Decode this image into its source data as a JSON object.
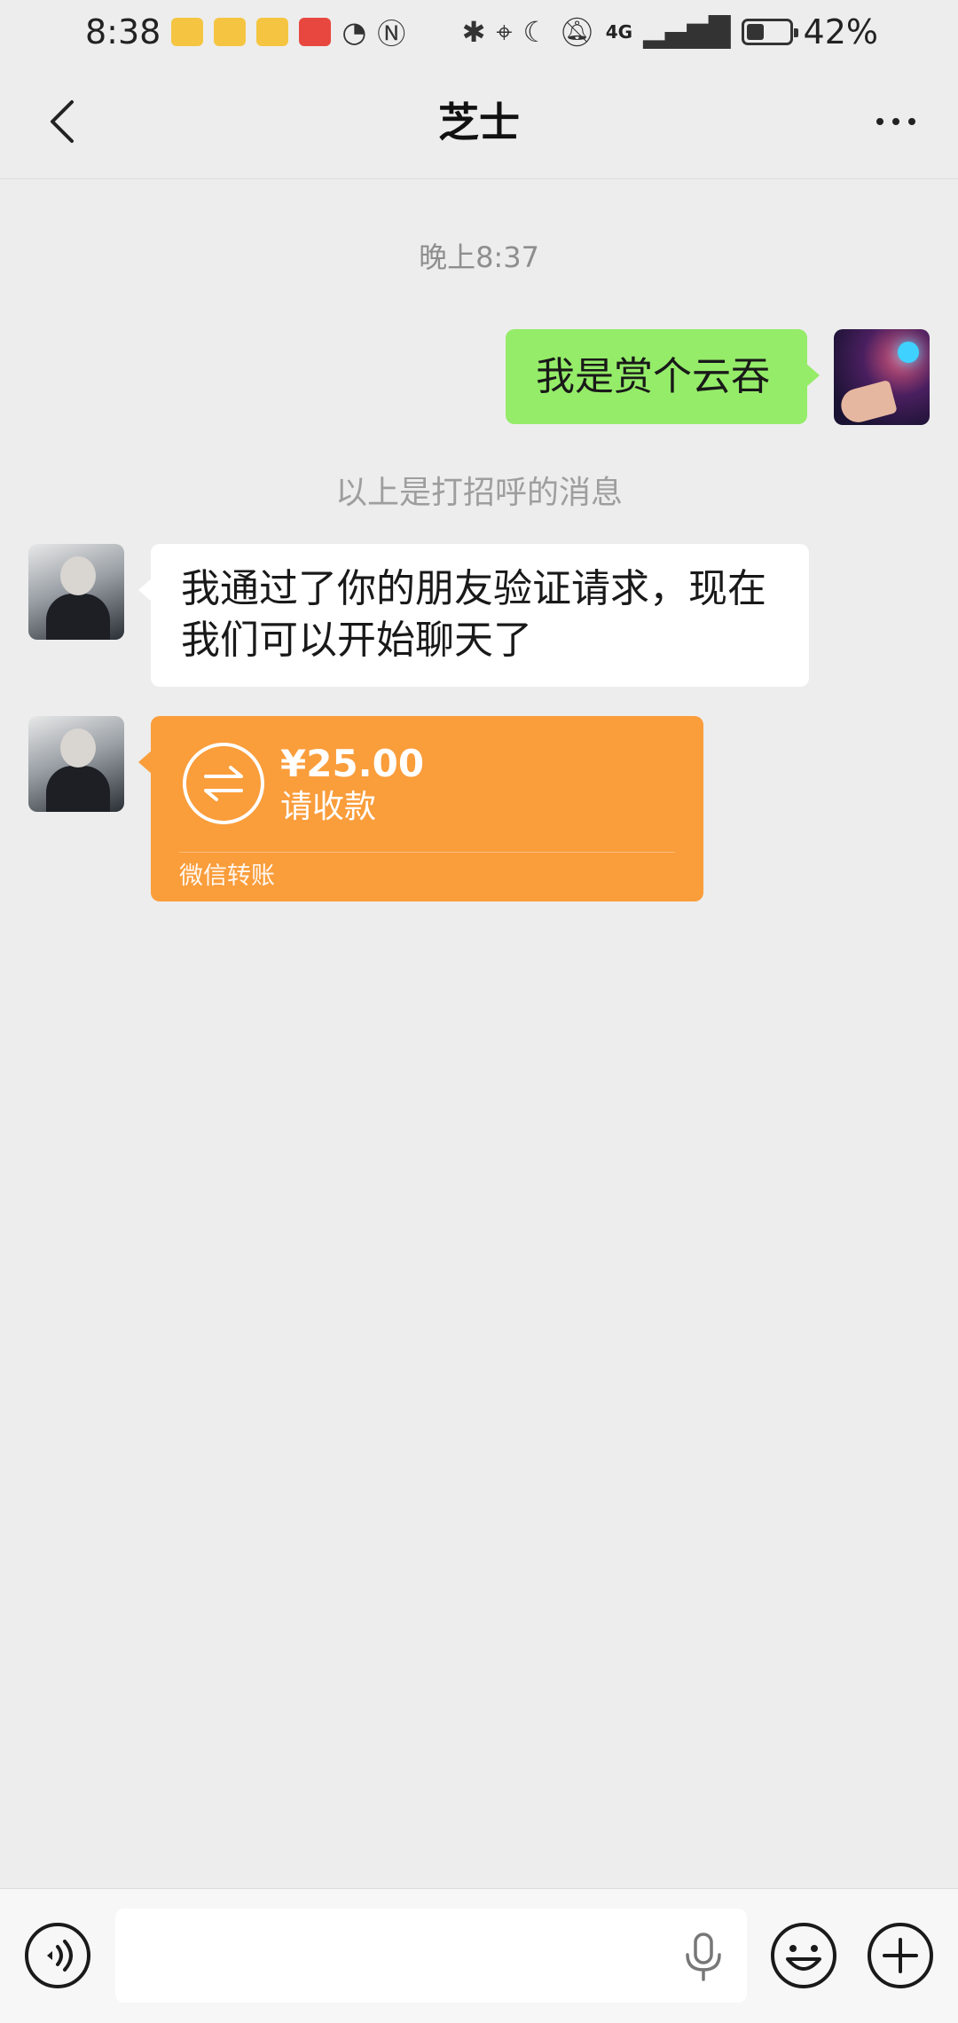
{
  "status_bar": {
    "time": "8:38",
    "network": "4G",
    "battery_percent_text": "42%",
    "battery_level": 0.42
  },
  "header": {
    "title": "芝士"
  },
  "chat": {
    "timestamp": "晚上8:37",
    "messages": [
      {
        "from": "self",
        "text": "我是赏个云吞"
      },
      {
        "from": "other",
        "text": "我通过了你的朋友验证请求，现在我们可以开始聊天了"
      }
    ],
    "system_notice": "以上是打招呼的消息",
    "transfer": {
      "amount": "¥25.00",
      "status": "请收款",
      "footer": "微信转账"
    }
  },
  "input_bar": {
    "placeholder": "",
    "value": ""
  },
  "colors": {
    "background": "#ededed",
    "self_bubble": "#95ec69",
    "other_bubble": "#ffffff",
    "transfer": "#fa9d3b"
  }
}
